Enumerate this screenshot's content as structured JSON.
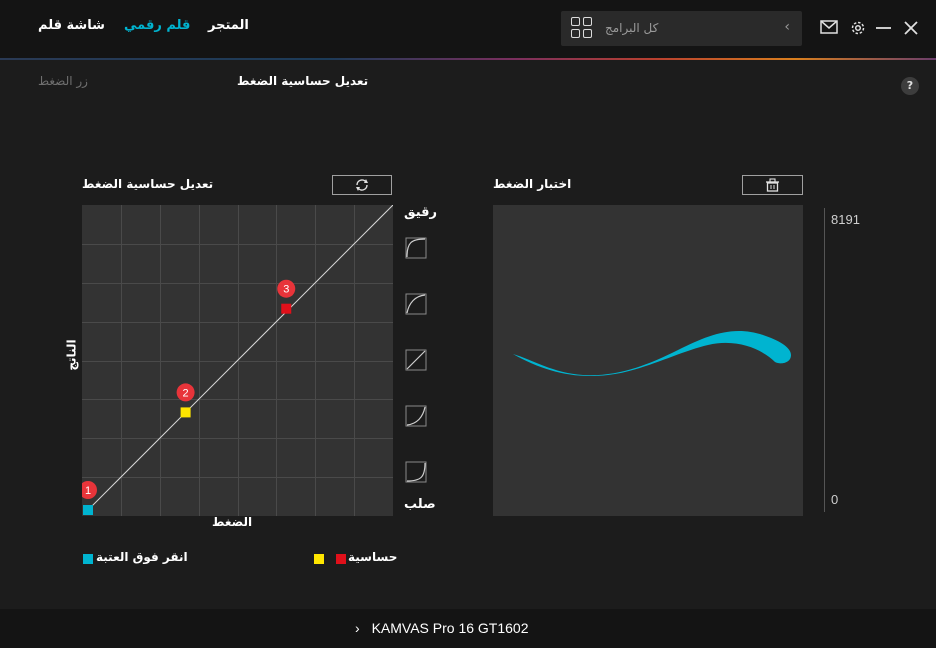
{
  "tabs": {
    "store": "المتجر",
    "tablet": "قلم رقمي",
    "display": "شاشة قلم"
  },
  "search": {
    "placeholder": "كل البرامج",
    "arrow": "‹"
  },
  "icons": {
    "grid": "grid-icon",
    "mail": "mail-icon",
    "settings": "gear-icon",
    "minimize": "minimize-icon",
    "close": "close-icon",
    "reset": "refresh-icon",
    "clear": "trash-icon",
    "help": "?"
  },
  "subbar": {
    "pen_button": "زر الضغط",
    "title": "تعديل حساسية الضغط"
  },
  "curve_panel": {
    "title": "تعديل حساسية الضغط",
    "soft_label": "رقيق",
    "hard_label": "صلب",
    "x_axis": "الضغط",
    "y_axis": "الناتج",
    "points": [
      {
        "label": "1",
        "color": "#00b4d0",
        "pressure": 0,
        "output": 0
      },
      {
        "label": "2",
        "color": "#ffe600",
        "pressure": 0.32,
        "output": 0.32
      },
      {
        "label": "3",
        "color": "#e0101a",
        "pressure": 0.65,
        "output": 0.66
      }
    ],
    "badge_color": "#e8343a"
  },
  "test_panel": {
    "title": "اختبار الضغط",
    "scale_max": "8191",
    "scale_min": "0",
    "stroke_color": "#00b4d0"
  },
  "legend": {
    "threshold": "انقر فوق العتبة",
    "sensitivity": "حساسية",
    "threshold_color": "#00b4d0",
    "sens_color_1": "#ffe600",
    "sens_color_2": "#e0101a"
  },
  "footer": {
    "chevron": "›",
    "device": "KAMVAS Pro 16 GT1602"
  }
}
